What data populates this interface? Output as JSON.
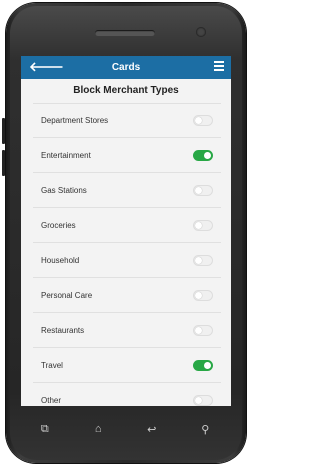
{
  "header": {
    "back_glyph": "🡐",
    "title": "Cards"
  },
  "section": {
    "title": "Block Merchant Types"
  },
  "items": [
    {
      "label": "Department Stores",
      "on": false
    },
    {
      "label": "Entertainment",
      "on": true
    },
    {
      "label": "Gas Stations",
      "on": false
    },
    {
      "label": "Groceries",
      "on": false
    },
    {
      "label": "Household",
      "on": false
    },
    {
      "label": "Personal Care",
      "on": false
    },
    {
      "label": "Restaurants",
      "on": false
    },
    {
      "label": "Travel",
      "on": true
    },
    {
      "label": "Other",
      "on": false
    }
  ],
  "navbar": {
    "recent_icon": "⧉",
    "home_icon": "⌂",
    "back_icon": "↩",
    "search_icon": "⚲"
  },
  "colors": {
    "header": "#1c6ea4",
    "toggle_on": "#28a745"
  }
}
